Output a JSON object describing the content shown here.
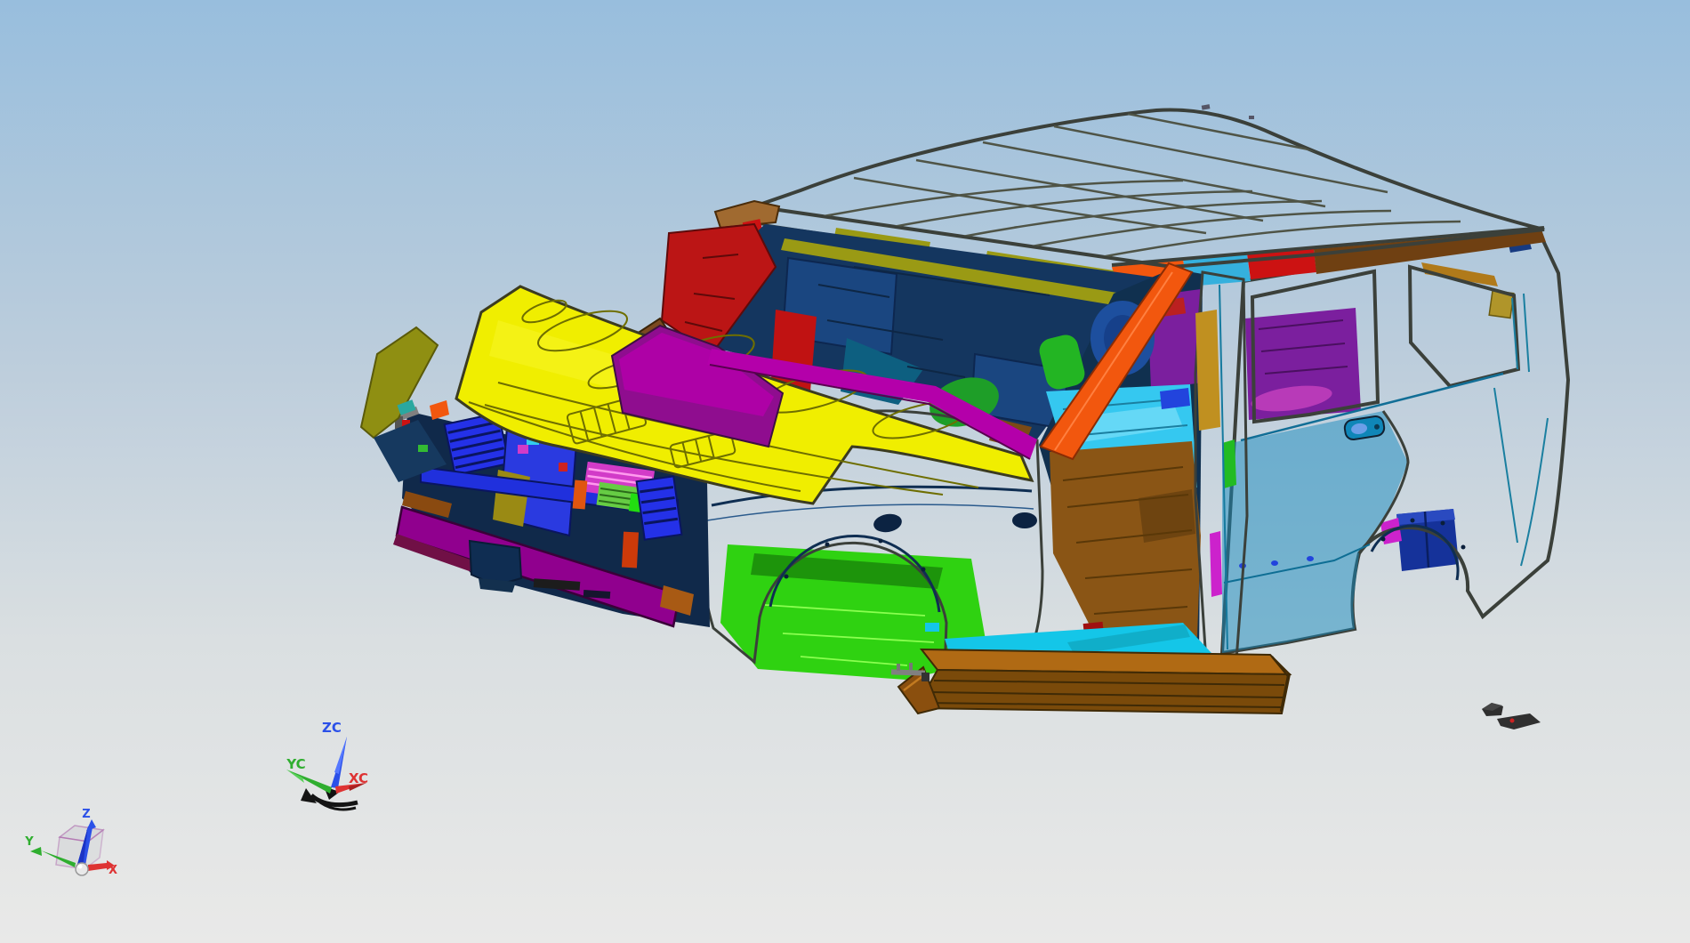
{
  "background": {
    "top": "#98bedd",
    "upper_mid": "#bccddc",
    "lower_mid": "#dadfe1",
    "bottom": "#e9e9e8"
  },
  "colors": {
    "roof": "#175097",
    "roof_grid": "#4f5446",
    "header_brown": "#7b4a16",
    "header_cap": "#a06a30",
    "rail_brown": "#6f4012",
    "hood": "#f0ee00",
    "hood_line": "#6e6e00",
    "cowl_magenta": "#b400aa",
    "cowl_purple": "#8f0d8f",
    "fender_navy": "#1d4a7c",
    "interior_navy": "#14365f",
    "door_interior_navy": "#10304f",
    "visor_navy": "#1a4680",
    "apillar_red": "#bb1515",
    "red_strip": "#c01212",
    "teal_wedge": "#0d5f80",
    "seat_green": "#1e9e28",
    "tube_green": "#23b523",
    "floor_green": "#2fd211",
    "floor_green_dark": "#1a8a0a",
    "floor_cyan": "#35c8f0",
    "sill_cyan": "#14c6e8",
    "tunnel_brown": "#8a5515",
    "rocker_top": "#b06a14",
    "rocker_face": "#7a4a0a",
    "orange": "#f2570e",
    "olive_strip": "#9a9a14",
    "olive_horn": "#8f8f12",
    "gold": "#c09020",
    "purple_trim": "#7b1f9e",
    "magenta_sliver": "#cc22cc",
    "quarter_light": "#33aedd",
    "quarter_deep": "#1589bd",
    "bpillar_cyan": "#35b0dd",
    "dpillar_navy": "#173a80",
    "navy_box": "#15329a",
    "radiator_blue": "#2431e8",
    "beam_blue": "#2030dd",
    "bright_blue": "#2244dd",
    "magenta_slat": "#d23bc8",
    "green_slat": "#66cc44",
    "bright_green": "#22dd11",
    "bumper_purple": "#90008e",
    "brown": "#8a4a10",
    "red": "#cc1212",
    "tow_navy": "#0f2d52",
    "clip_navy": "#10294a",
    "speaker_blue": "#1d4f9e",
    "dark_part": "#2e2e2e",
    "gray_part": "#808080",
    "axis_red": "#de3333",
    "axis_green": "#2fae2f",
    "axis_blue": "#2b50e8",
    "cube_edge": "#a55aa5",
    "cube_face": "#d0d0d4",
    "sphere": "#e9e9e9"
  },
  "wcs_triad": {
    "z_label": "ZC",
    "y_label": "YC",
    "x_label": "XC"
  },
  "view_axis": {
    "z_label": "Z",
    "y_label": "Y",
    "x_label": "X"
  }
}
